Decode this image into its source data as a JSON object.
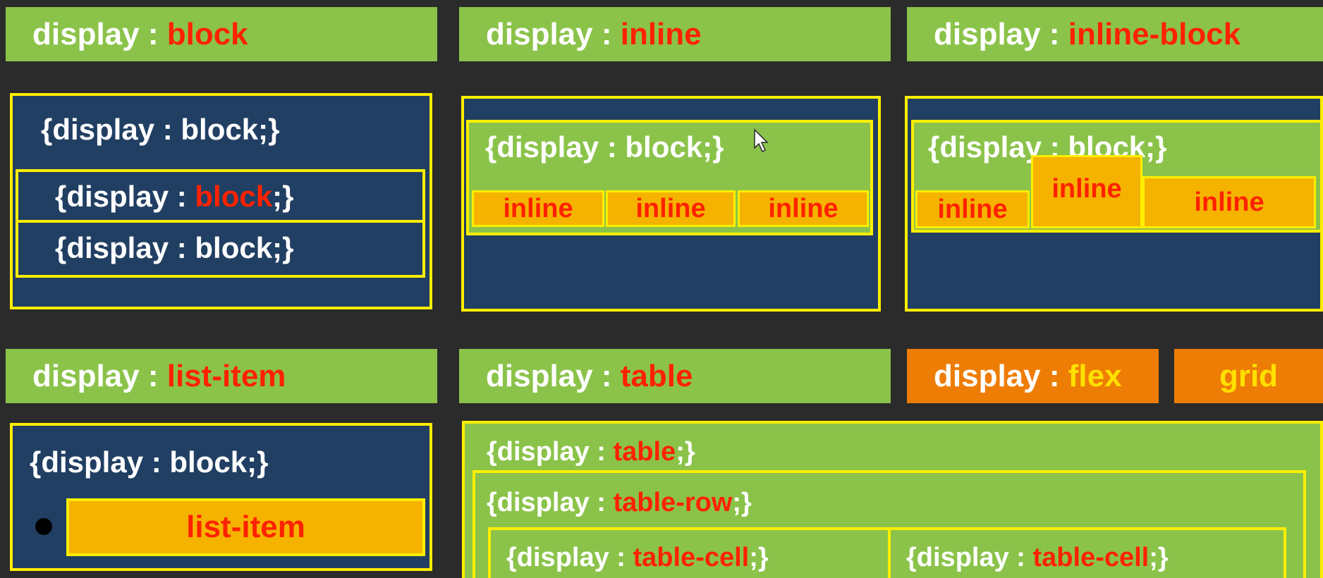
{
  "headers": {
    "block": {
      "prefix": "display : ",
      "keyword": "block"
    },
    "inline": {
      "prefix": "display : ",
      "keyword": "inline"
    },
    "inline_block": {
      "prefix": "display : ",
      "keyword": "inline-block"
    },
    "list_item": {
      "prefix": "display : ",
      "keyword": "list-item"
    },
    "table": {
      "prefix": "display : ",
      "keyword": "table"
    },
    "flex": {
      "prefix": "display : ",
      "keyword": "flex"
    },
    "grid": {
      "keyword": "grid"
    }
  },
  "block_demo": {
    "outer": "{display : block;}",
    "inner1_prefix": "{display : ",
    "inner1_keyword": "block",
    "inner1_suffix": ";}",
    "inner2": "{display : block;}"
  },
  "inline_demo": {
    "container": "{display : block;}",
    "items": [
      "inline",
      "inline",
      "inline"
    ]
  },
  "inline_block_demo": {
    "container": "{display : block;}",
    "items": [
      "inline",
      "inline",
      "inline"
    ]
  },
  "list_item_demo": {
    "container": "{display : block;}",
    "item": "list-item"
  },
  "table_demo": {
    "table_prefix": "{display : ",
    "table_keyword": "table",
    "table_suffix": ";}",
    "row_prefix": "{display : ",
    "row_keyword": "table-row",
    "row_suffix": ";}",
    "cells": [
      {
        "prefix": "{display : ",
        "keyword": "table-cell",
        "suffix": ";}"
      },
      {
        "prefix": "{display : ",
        "keyword": "table-cell",
        "suffix": ";}"
      }
    ]
  },
  "colors": {
    "header_green": "#8bc34a",
    "header_orange": "#ee7d05",
    "navy": "#213f63",
    "border_yellow": "#ffee00",
    "keyword_red": "#ff2200",
    "inline_box_orange": "#f5b300"
  },
  "icons": [
    "mouse-cursor-icon",
    "bullet-icon"
  ]
}
